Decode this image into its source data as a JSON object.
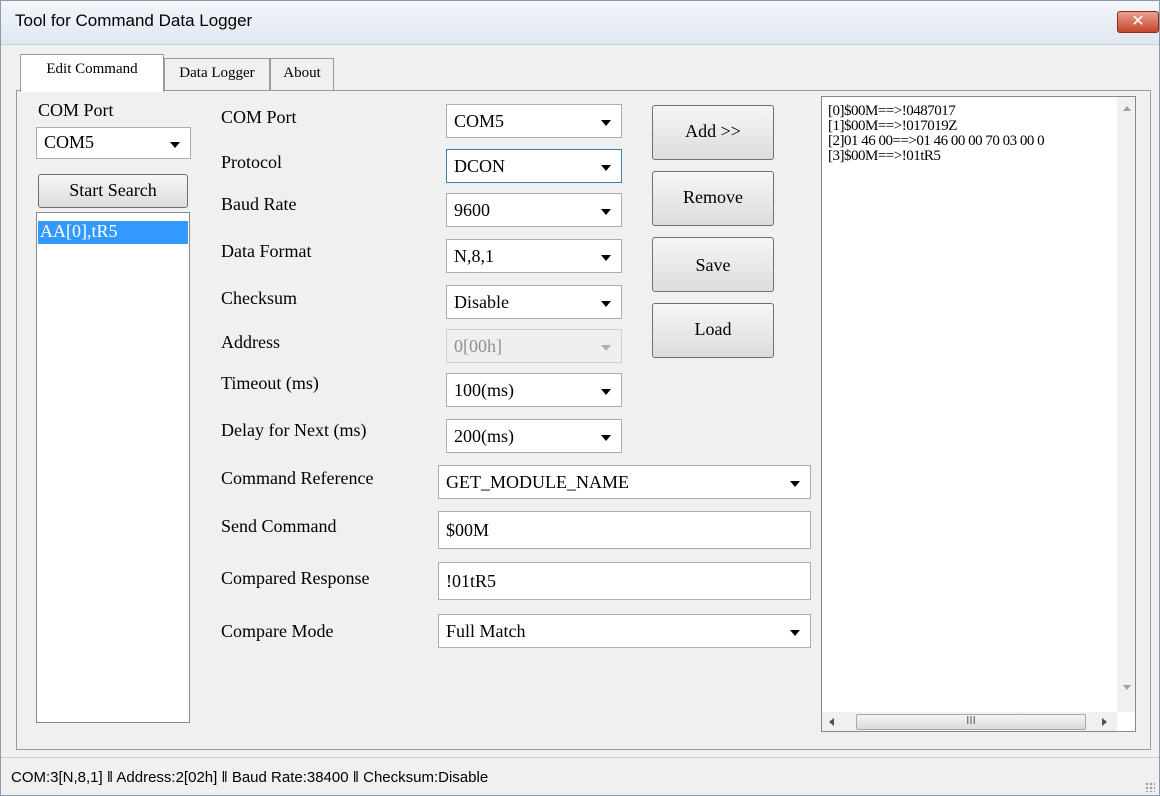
{
  "window": {
    "title": "Tool for Command Data Logger",
    "close_glyph": "✕"
  },
  "tabs": [
    {
      "label": "Edit Command",
      "active": true
    },
    {
      "label": "Data Logger",
      "active": false
    },
    {
      "label": "About",
      "active": false
    }
  ],
  "left_panel": {
    "com_port_label": "COM Port",
    "com_port_value": "COM5",
    "start_search_label": "Start Search",
    "list_items": [
      "AA[0],tR5"
    ]
  },
  "form": {
    "com_port": {
      "label": "COM Port",
      "value": "COM5"
    },
    "protocol": {
      "label": "Protocol",
      "value": "DCON"
    },
    "baud_rate": {
      "label": "Baud Rate",
      "value": "9600"
    },
    "data_format": {
      "label": "Data Format",
      "value": "N,8,1"
    },
    "checksum": {
      "label": "Checksum",
      "value": "Disable"
    },
    "address": {
      "label": "Address",
      "value": "0[00h]"
    },
    "timeout": {
      "label": "Timeout (ms)",
      "value": "100(ms)"
    },
    "delay_next": {
      "label": "Delay for Next (ms)",
      "value": "200(ms)"
    },
    "command_reference": {
      "label": "Command Reference",
      "value": "GET_MODULE_NAME"
    },
    "send_command": {
      "label": "Send Command",
      "value": "$00M"
    },
    "compared_response": {
      "label": "Compared Response",
      "value": "!01tR5"
    },
    "compare_mode": {
      "label": "Compare Mode",
      "value": "Full Match"
    }
  },
  "buttons": {
    "add": "Add >>",
    "remove": "Remove",
    "save": "Save",
    "load": "Load"
  },
  "command_log": [
    "[0]$00M==>!0487017",
    "[1]$00M==>!017019Z",
    "[2]01 46 00==>01 46 00 00 70 03 00 0",
    "[3]$00M==>!01tR5"
  ],
  "scrollbar": {
    "thumb_glyph": "III"
  },
  "status": {
    "text": "COM:3[N,8,1] ‖ Address:2[02h] ‖ Baud Rate:38400 ‖ Checksum:Disable"
  },
  "colors": {
    "selection": "#3399ff",
    "close_button": "#c7452c",
    "focus_border": "#3c7fb1"
  }
}
